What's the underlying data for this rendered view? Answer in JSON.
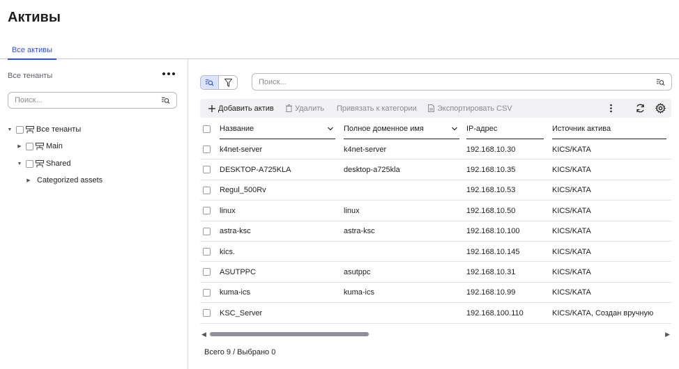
{
  "page": {
    "title": "Активы"
  },
  "tabs": [
    {
      "label": "Все активы",
      "active": true
    }
  ],
  "sidebar": {
    "header": "Все тенанты",
    "search": {
      "placeholder": "Поиск..."
    },
    "tree": [
      {
        "label": "Все тенанты",
        "expanded": true,
        "has_checkbox": true,
        "icon": "hierarchy-icon"
      },
      {
        "label": "Main",
        "expanded": false,
        "has_checkbox": true,
        "icon": "hierarchy-icon"
      },
      {
        "label": "Shared",
        "expanded": true,
        "has_checkbox": true,
        "icon": "hierarchy-icon"
      },
      {
        "label": "Categorized assets",
        "expanded": false,
        "has_checkbox": false,
        "icon": ""
      }
    ]
  },
  "main": {
    "search": {
      "placeholder": "Поиск..."
    },
    "toolbar": {
      "add": "Добавить актив",
      "delete": "Удалить",
      "bind": "Привязать к категории",
      "export": "Экспортировать CSV"
    },
    "columns": [
      "Название",
      "Полное доменное имя",
      "IP-адрес",
      "Источник актива"
    ],
    "rows": [
      {
        "name": "k4net-server",
        "fqdn": "k4net-server",
        "ip": "192.168.10.30",
        "source": "KICS/KATA"
      },
      {
        "name": "DESKTOP-A725KLA",
        "fqdn": "desktop-a725kla",
        "ip": "192.168.10.35",
        "source": "KICS/KATA"
      },
      {
        "name": "Regul_500Rv",
        "fqdn": "",
        "ip": "192.168.10.53",
        "source": "KICS/KATA"
      },
      {
        "name": "linux",
        "fqdn": "linux",
        "ip": "192.168.10.50",
        "source": "KICS/KATA"
      },
      {
        "name": "astra-ksc",
        "fqdn": "astra-ksc",
        "ip": "192.168.10.100",
        "source": "KICS/KATA"
      },
      {
        "name": "kics.",
        "fqdn": "",
        "ip": "192.168.10.145",
        "source": "KICS/KATA"
      },
      {
        "name": "ASUTPPC",
        "fqdn": "asutppc",
        "ip": "192.168.10.31",
        "source": "KICS/KATA"
      },
      {
        "name": "kuma-ics",
        "fqdn": "kuma-ics",
        "ip": "192.168.10.99",
        "source": "KICS/KATA"
      },
      {
        "name": "KSC_Server",
        "fqdn": "",
        "ip": "192.168.100.110",
        "source": "KICS/KATA, Создан вручную"
      }
    ],
    "footer": "Всего 9 / Выбрано 0"
  },
  "colors": {
    "accent": "#2f4fd8",
    "toolbar_bg": "#f1f1f3",
    "active_toggle": "#dbe3ff"
  }
}
